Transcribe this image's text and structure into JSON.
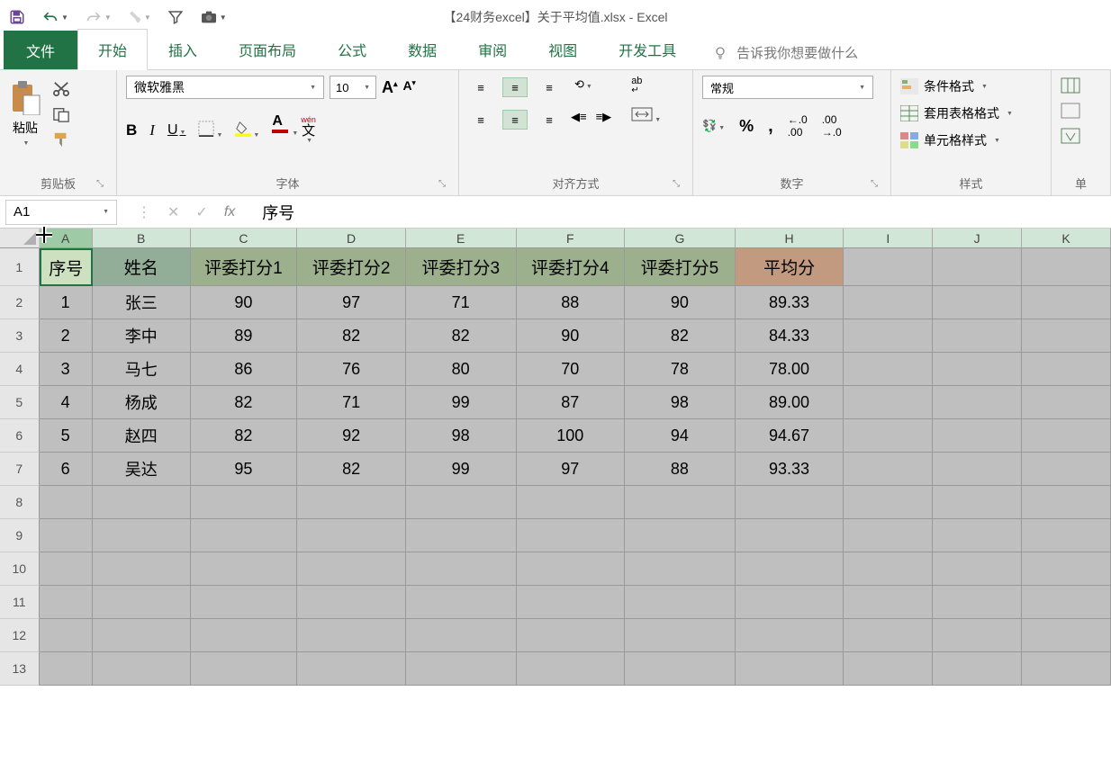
{
  "title": "【24财务excel】关于平均值.xlsx  -  Excel",
  "tabs": {
    "file": "文件",
    "home": "开始",
    "insert": "插入",
    "layout": "页面布局",
    "formulas": "公式",
    "data": "数据",
    "review": "审阅",
    "view": "视图",
    "dev": "开发工具",
    "tell": "告诉我你想要做什么"
  },
  "ribbon": {
    "clipboard": {
      "paste": "粘贴",
      "label": "剪贴板"
    },
    "font": {
      "name": "微软雅黑",
      "size": "10",
      "label": "字体",
      "wen": "wén",
      "wen2": "文"
    },
    "align": {
      "label": "对齐方式",
      "wrap": "ab"
    },
    "number": {
      "format": "常规",
      "label": "数字"
    },
    "styles": {
      "cond": "条件格式",
      "table": "套用表格格式",
      "cell": "单元格样式",
      "label": "样式"
    },
    "cells": {
      "label": "单"
    }
  },
  "namebox": "A1",
  "formula": "序号",
  "columns": [
    "A",
    "B",
    "C",
    "D",
    "E",
    "F",
    "G",
    "H",
    "I",
    "J",
    "K"
  ],
  "row_nums": [
    "1",
    "2",
    "3",
    "4",
    "5",
    "6",
    "7",
    "8",
    "9",
    "10",
    "11",
    "12",
    "13"
  ],
  "headers": [
    "序号",
    "姓名",
    "评委打分1",
    "评委打分2",
    "评委打分3",
    "评委打分4",
    "评委打分5",
    "平均分"
  ],
  "rows": [
    {
      "idx": "1",
      "name": "张三",
      "s": [
        "90",
        "97",
        "71",
        "88",
        "90"
      ],
      "avg": "89.33"
    },
    {
      "idx": "2",
      "name": "李中",
      "s": [
        "89",
        "82",
        "82",
        "90",
        "82"
      ],
      "avg": "84.33"
    },
    {
      "idx": "3",
      "name": "马七",
      "s": [
        "86",
        "76",
        "80",
        "70",
        "78"
      ],
      "avg": "78.00"
    },
    {
      "idx": "4",
      "name": "杨成",
      "s": [
        "82",
        "71",
        "99",
        "87",
        "98"
      ],
      "avg": "89.00"
    },
    {
      "idx": "5",
      "name": "赵四",
      "s": [
        "82",
        "92",
        "98",
        "100",
        "94"
      ],
      "avg": "94.67"
    },
    {
      "idx": "6",
      "name": "吴达",
      "s": [
        "95",
        "82",
        "99",
        "97",
        "88"
      ],
      "avg": "93.33"
    }
  ],
  "chart_data": {
    "type": "table",
    "title": "关于平均值",
    "columns": [
      "序号",
      "姓名",
      "评委打分1",
      "评委打分2",
      "评委打分3",
      "评委打分4",
      "评委打分5",
      "平均分"
    ],
    "rows": [
      [
        1,
        "张三",
        90,
        97,
        71,
        88,
        90,
        89.33
      ],
      [
        2,
        "李中",
        89,
        82,
        82,
        90,
        82,
        84.33
      ],
      [
        3,
        "马七",
        86,
        76,
        80,
        70,
        78,
        78.0
      ],
      [
        4,
        "杨成",
        82,
        71,
        99,
        87,
        98,
        89.0
      ],
      [
        5,
        "赵四",
        82,
        92,
        98,
        100,
        94,
        94.67
      ],
      [
        6,
        "吴达",
        95,
        82,
        99,
        97,
        88,
        93.33
      ]
    ]
  }
}
